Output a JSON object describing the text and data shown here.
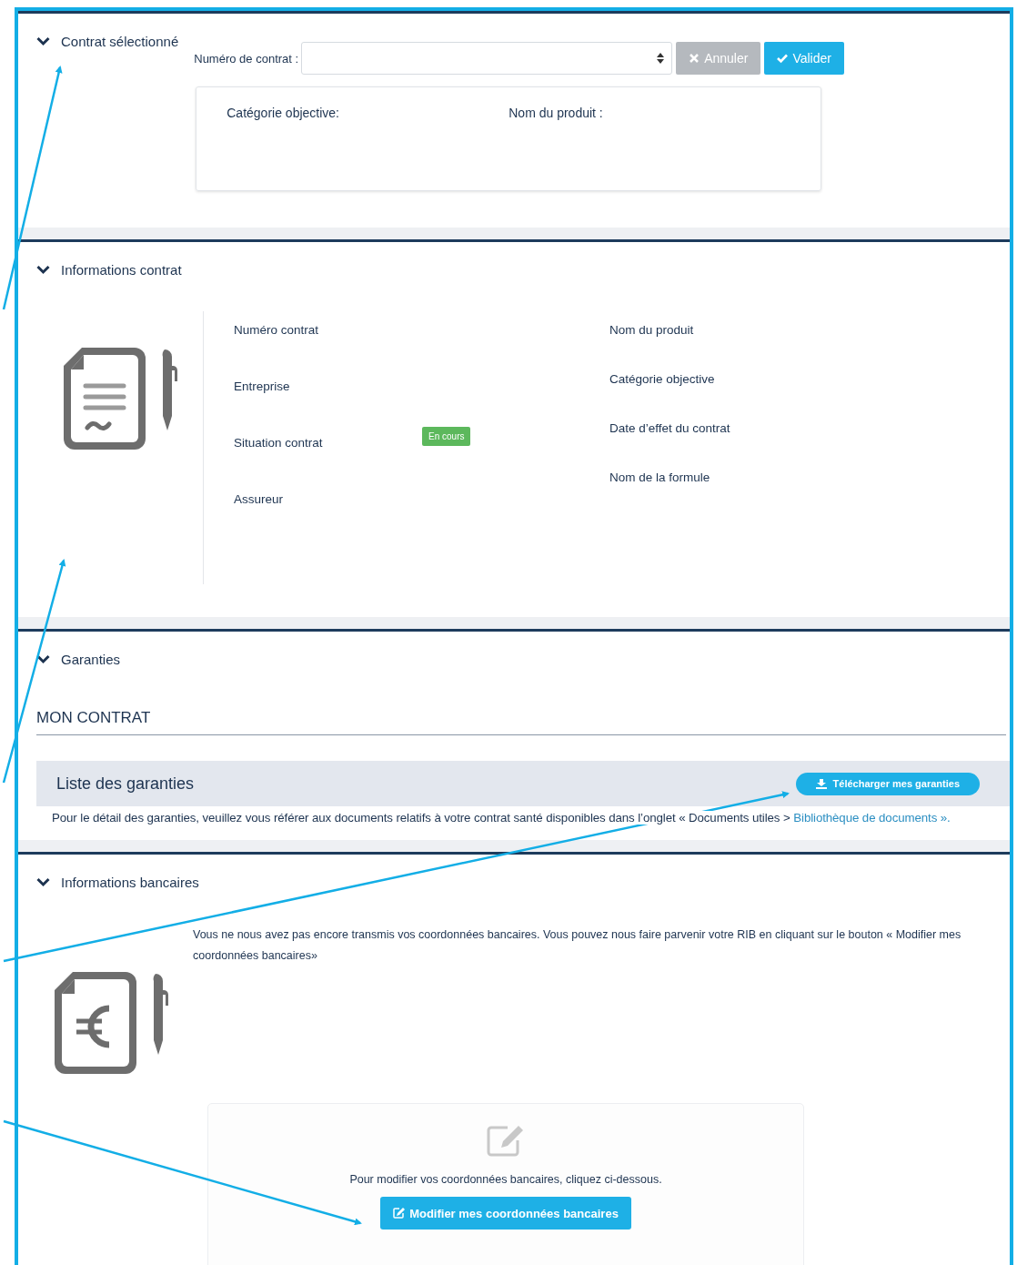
{
  "sections": [
    {
      "kind": "contract_select",
      "title": "Contrat sélectionné",
      "expanded": true,
      "field_label": "Numéro de contrat :",
      "buttons": [
        {
          "kind": "cancel",
          "label": "Annuler"
        },
        {
          "kind": "confirm",
          "label": "Valider"
        }
      ],
      "summary": [
        {
          "label": "Catégorie objective:"
        },
        {
          "label": "Nom du produit :"
        }
      ]
    },
    {
      "kind": "contract_info",
      "title": "Informations contrat",
      "expanded": true,
      "left_fields": [
        {
          "label": "Numéro contrat"
        },
        {
          "label": "Entreprise"
        },
        {
          "label": "Situation contrat",
          "badge": "En cours"
        },
        {
          "label": "Assureur"
        }
      ],
      "right_fields": [
        {
          "label": "Nom du produit"
        },
        {
          "label": "Catégorie objective"
        },
        {
          "label": "Date d’effet du contrat"
        },
        {
          "label": "Nom de la formule"
        }
      ]
    },
    {
      "kind": "guarantees",
      "title": "Garanties",
      "expanded": true,
      "heading": "MON CONTRAT",
      "list_title": "Liste des garanties",
      "button": "Télécharger mes garanties",
      "note": "Pour le détail des garanties, veuillez vous référer aux documents relatifs à votre contrat santé disponibles dans l’onglet « Documents utiles > ",
      "note_link": "Bibliothèque de documents »."
    },
    {
      "kind": "bank_info",
      "title": "Informations bancaires",
      "expanded": true,
      "message": "Vous ne nous avez pas encore transmis vos coordonnées bancaires. Vous pouvez nous faire parvenir votre RIB en cliquant sur le bouton « Modifier mes coordonnées bancaires»",
      "card_text": "Pour modifier vos coordonnées bancaires, cliquez ci-dessous.",
      "button": "Modifier mes coordonnées bancaires"
    }
  ]
}
